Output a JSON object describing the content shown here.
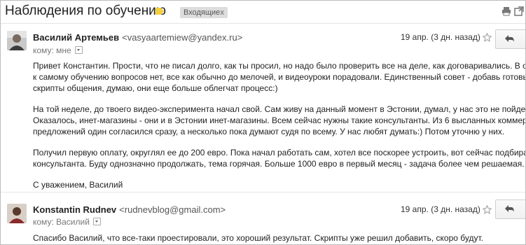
{
  "thread": {
    "subject": "Наблюдения по обучению",
    "label": "Входящие",
    "label_remove": "x"
  },
  "messages": [
    {
      "sender_name": "Василий Артемьев",
      "sender_email": "<vasyaartemiew@yandex.ru>",
      "to_label": "кому: мне",
      "date": "19 апр. (3 дн. назад)",
      "lines": [
        "Привет Константин. Прости, что не писал долго, как ты просил, но надо было проверить все на деле, как договаривались. В общем,",
        "к самому обучению вопросов нет, все как обычно до мелочей, и видеоуроки порадовали. Единственный совет - добавь готовые",
        "скрипты общения, думаю, они еще больше облегчат процесс:)",
        "На той неделе, до твоего видео-эксперимента начал свой. Сам живу на данный момент в Эстонии, думал, у нас это не пойдет.",
        "Оказалось, инет-магазины - они и в Эстонии инет-магазины. Всем сейчас нужны такие консультанты. Из 6 высланных коммерческих",
        "предложений один согласился сразу, а несколько пока думают судя по всему. У нас любят думать:) Потом уточню у них.",
        "Получил первую оплату, округлял ее до 200 евро. Пока начал работать сам, хотел все поскорее устроить, вот сейчас подбираю",
        "консультанта. Буду однозначно продолжать, тема горячая. Больше 1000 евро в первый месяц - задача более чем решаемая.",
        "С уважением, Василий"
      ]
    },
    {
      "sender_name": "Konstantin Rudnev",
      "sender_email": "<rudnevblog@gmail.com>",
      "to_label": "кому: Василий",
      "date": "19 апр. (3 дн. назад)",
      "lines": [
        "Спасибо Василий, что все-таки проестировали, это хороший результат. Скрипты уже решил добавить, скоро будут."
      ]
    }
  ],
  "colors": {
    "label_tag": "#f4d03f",
    "chip_bg": "#dddddd"
  },
  "icons": [
    "label-tag-icon",
    "print-icon",
    "new-window-icon",
    "star-icon",
    "reply-icon",
    "chevron-down-icon"
  ]
}
